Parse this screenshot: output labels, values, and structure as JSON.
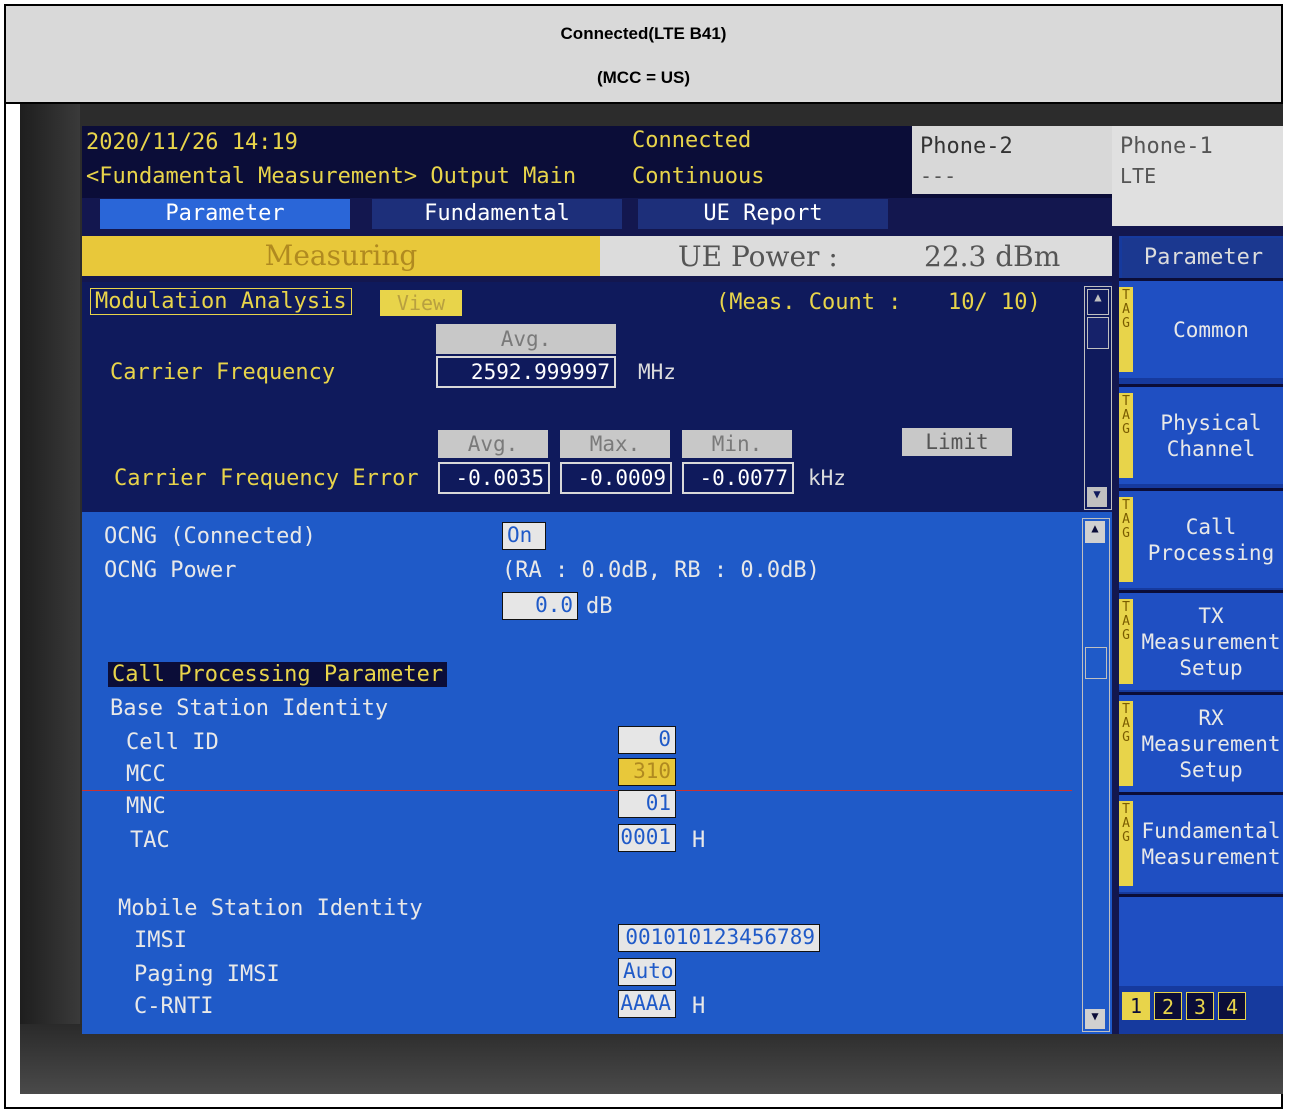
{
  "header": {
    "line1": "Connected(LTE B41)",
    "line2": "(MCC = US)"
  },
  "screen": {
    "datetime": "2020/11/26 14:19",
    "screen_name": "<Fundamental Measurement> Output Main",
    "status_connected": "Connected",
    "status_mode": "Continuous",
    "phone2_label": "Phone-2",
    "phone2_value": "---",
    "phone1_label": "Phone-1",
    "phone1_value": "LTE",
    "tabs": [
      "Parameter",
      "Fundamental",
      "UE Report"
    ],
    "measuring": "Measuring",
    "ue_power_label": "UE Power :",
    "ue_power_value": "22.3 dBm",
    "side_title": "Parameter"
  },
  "modulation": {
    "title": "Modulation Analysis",
    "view_button": "View",
    "meas_count_label": "(Meas. Count :",
    "meas_count_value": "10/  10)",
    "avg_header": "Avg.",
    "carrier_freq_label": "Carrier Frequency",
    "carrier_freq_value": "2592.999997",
    "carrier_freq_unit": "MHz",
    "avg_label": "Avg.",
    "max_label": "Max.",
    "min_label": "Min.",
    "limit_button": "Limit",
    "cfe_label": "Carrier Frequency Error",
    "cfe_avg": "-0.0035",
    "cfe_max": "-0.0009",
    "cfe_min": "-0.0077",
    "cfe_unit": "kHz"
  },
  "params": {
    "ocng_connected_label": "OCNG (Connected)",
    "ocng_connected_value": "On",
    "ocng_power_label": "OCNG Power",
    "ocng_power_info": "(RA :     0.0dB, RB :       0.0dB)",
    "ocng_power_value": "0.0",
    "ocng_power_unit": "dB",
    "section_title": "Call Processing Parameter",
    "bsi_label": "Base Station Identity",
    "cell_id_label": "Cell ID",
    "cell_id_value": "0",
    "mcc_label": "MCC",
    "mcc_value": "310",
    "mnc_label": "MNC",
    "mnc_value": "01",
    "tac_label": "TAC",
    "tac_value": "0001",
    "tac_unit": "H",
    "msi_label": "Mobile Station Identity",
    "imsi_label": "IMSI",
    "imsi_value": "001010123456789",
    "paging_imsi_label": "Paging IMSI",
    "paging_imsi_value": "Auto",
    "crnti_label": "C-RNTI",
    "crnti_value": "AAAA",
    "crnti_unit": "H"
  },
  "side_buttons": [
    {
      "label": "Common",
      "tag": "T\nA\nG"
    },
    {
      "label": "Physical\nChannel",
      "tag": "T\nA\nG"
    },
    {
      "label": "Call\nProcessing",
      "tag": "T\nA\nG"
    },
    {
      "label": "TX\nMeasurement\nSetup",
      "tag": "T\nA\nG"
    },
    {
      "label": "RX\nMeasurement\nSetup",
      "tag": "T\nA\nG"
    },
    {
      "label": "Fundamental\nMeasurement",
      "tag": "T\nA\nG"
    }
  ],
  "pages": [
    "1",
    "2",
    "3",
    "4"
  ]
}
